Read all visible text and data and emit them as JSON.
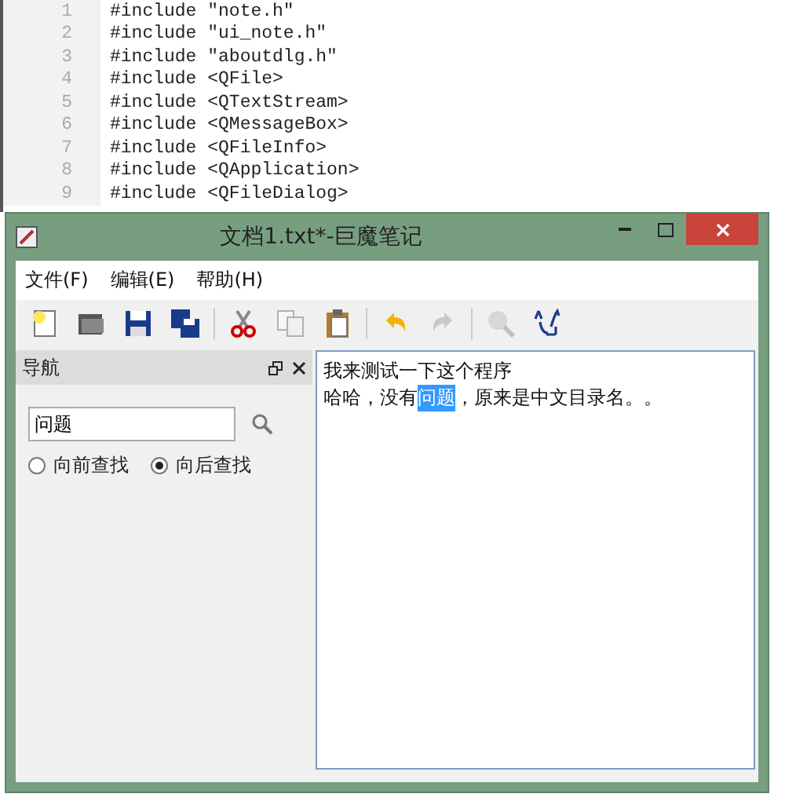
{
  "code_editor": {
    "lines": [
      {
        "number": "1",
        "code": "#include \"note.h\""
      },
      {
        "number": "2",
        "code": "#include \"ui_note.h\""
      },
      {
        "number": "3",
        "code": "#include \"aboutdlg.h\""
      },
      {
        "number": "4",
        "code": "#include <QFile>"
      },
      {
        "number": "5",
        "code": "#include <QTextStream>"
      },
      {
        "number": "6",
        "code": "#include <QMessageBox>"
      },
      {
        "number": "7",
        "code": "#include <QFileInfo>"
      },
      {
        "number": "8",
        "code": "#include <QApplication>"
      },
      {
        "number": "9",
        "code": "#include <QFileDialog>"
      }
    ]
  },
  "window": {
    "title": "文档1.txt*-巨魔笔记"
  },
  "menu": [
    "文件(F)",
    "编辑(E)",
    "帮助(H)"
  ],
  "toolbar": [
    {
      "disabled": false
    },
    {
      "disabled": false
    },
    {
      "disabled": false
    },
    {
      "disabled": false
    },
    {
      "disabled": false
    },
    {
      "disabled": true
    },
    {
      "disabled": false
    },
    {
      "disabled": false
    },
    {
      "disabled": true
    },
    {
      "disabled": true
    },
    {
      "disabled": false
    }
  ],
  "navigation": {
    "title": "导航",
    "search": {
      "value": "问题"
    },
    "options": [
      {
        "label": "向前查找",
        "selected": false
      },
      {
        "label": "向后查找",
        "selected": true
      }
    ]
  },
  "document": {
    "lines": [
      {
        "segments": [
          {
            "text": "我来测试一下这个程序",
            "selected": false
          }
        ]
      },
      {
        "segments": [
          {
            "text": "哈哈，没有",
            "selected": false
          },
          {
            "text": "问题",
            "selected": true
          },
          {
            "text": "，原来是中文目录名。。",
            "selected": false
          }
        ]
      }
    ]
  }
}
